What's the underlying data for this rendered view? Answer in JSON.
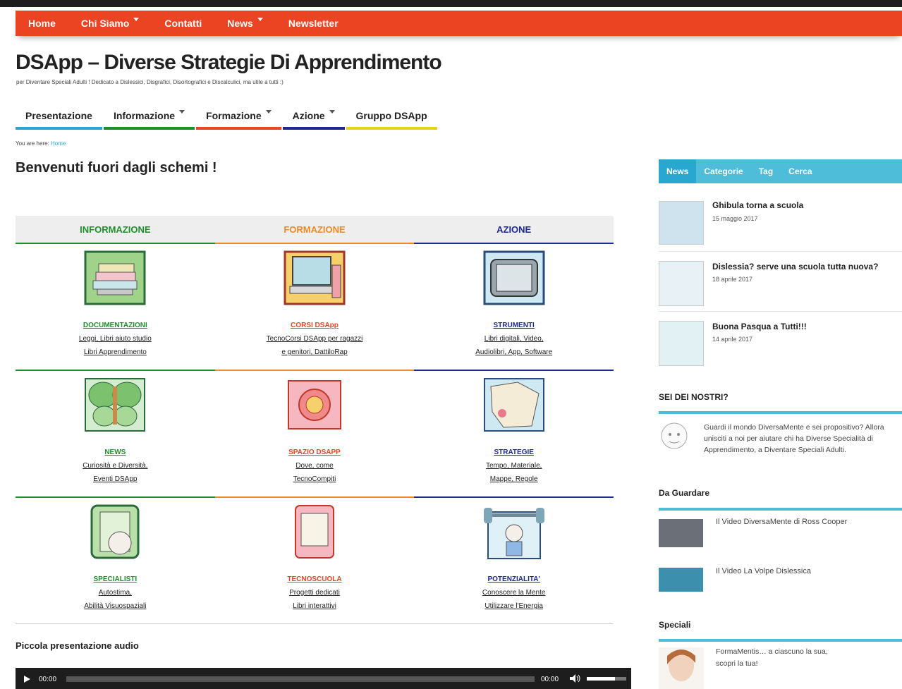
{
  "top_nav": [
    {
      "label": "Home",
      "dropdown": false
    },
    {
      "label": "Chi Siamo",
      "dropdown": true
    },
    {
      "label": "Contatti",
      "dropdown": false
    },
    {
      "label": "News",
      "dropdown": true
    },
    {
      "label": "Newsletter",
      "dropdown": false
    }
  ],
  "site": {
    "title": "DSApp – Diverse Strategie Di Apprendimento",
    "description": "per Diventare Speciali Adulti ! Dedicato a Dislessici, Disgrafici, Disortografici e Discalculici, ma utile a tutti :)"
  },
  "main_nav": [
    {
      "label": "Presentazione",
      "dropdown": false,
      "color": "#2aa7d1"
    },
    {
      "label": "Informazione",
      "dropdown": true,
      "color": "#1f8f2c"
    },
    {
      "label": "Formazione",
      "dropdown": true,
      "color": "#ea4423"
    },
    {
      "label": "Azione",
      "dropdown": true,
      "color": "#1e2a8f"
    },
    {
      "label": "Gruppo DSApp",
      "dropdown": false,
      "color": "#e6d21a"
    }
  ],
  "breadcrumb": {
    "prefix": "You are here:",
    "home": "Home"
  },
  "page_title": "Benvenuti fuori dagli schemi !",
  "grid": {
    "headers": [
      {
        "label": "INFORMAZIONE",
        "color": "#1f8f2c"
      },
      {
        "label": "FORMAZIONE",
        "color": "#f08a24"
      },
      {
        "label": "AZIONE",
        "color": "#1e2a8f"
      }
    ],
    "rows": [
      [
        {
          "title": "DOCUMENTAZIONI",
          "l1": "Leggi, Libri aiuto studio",
          "l2": "Libri Apprendimento",
          "icon": "books-icon"
        },
        {
          "title": "CORSI DSApp",
          "l1": "TecnoCorsi DSApp per ragazzi",
          "l2": "e genitori, DattiloRap",
          "icon": "computer-icon"
        },
        {
          "title": "STRUMENTI",
          "l1": "Libri digitali, Video,",
          "l2": "Audiolibri, App, Software",
          "icon": "tablet-icon"
        }
      ],
      [
        {
          "title": "NEWS",
          "l1": "Curiosità e Diversità,",
          "l2": "Eventi DSApp",
          "icon": "butterfly-icon"
        },
        {
          "title": "SPAZIO DSAPP",
          "l1": "Dove, come",
          "l2": "TecnoCompiti",
          "icon": "sun-icon"
        },
        {
          "title": "STRATEGIE",
          "l1": "Tempo, Materiale,",
          "l2": "Mappe, Regole",
          "icon": "map-icon"
        }
      ],
      [
        {
          "title": "SPECIALISTI",
          "l1": "Autostima,",
          "l2": "Abilità Visuospaziali",
          "icon": "specialist-icon"
        },
        {
          "title": "TECNOSCUOLA",
          "l1": "Progetti dedicati",
          "l2": "Libri interattivi",
          "icon": "ebook-icon"
        },
        {
          "title": "POTENZIALITA'",
          "l1": "Conoscere la Mente",
          "l2": "Utilizzare l'Energia",
          "icon": "weightlifter-icon"
        }
      ]
    ]
  },
  "audio": {
    "title": "Piccola presentazione audio",
    "current": "00:00",
    "duration": "00:00"
  },
  "sidebar": {
    "tabs": [
      "News",
      "Categorie",
      "Tag",
      "Cerca"
    ],
    "news": [
      {
        "title": "Ghibula torna a scuola",
        "date": "15 maggio 2017"
      },
      {
        "title": "Dislessia? serve una scuola tutta nuova?",
        "date": "18 aprile 2017"
      },
      {
        "title": "Buona Pasqua a Tutti!!!",
        "date": "14 aprile 2017"
      }
    ],
    "sei_dei_nostri": {
      "title": "SEI DEI NOSTRI?",
      "text": "Guardi il mondo DiversaMente e sei propositivo? Allora unisciti a noi per aiutare chi ha Diverse Specialità di Apprendimento, a Diventare Speciali Adulti."
    },
    "da_guardare": {
      "title": "Da Guardare",
      "items": [
        "Il Video DiversaMente di Ross Cooper",
        "Il Video La Volpe Dislessica"
      ]
    },
    "speciali": {
      "title": "Speciali",
      "text1": "FormaMentis… a ciascuno la sua,",
      "text2": "scopri la tua!"
    }
  }
}
